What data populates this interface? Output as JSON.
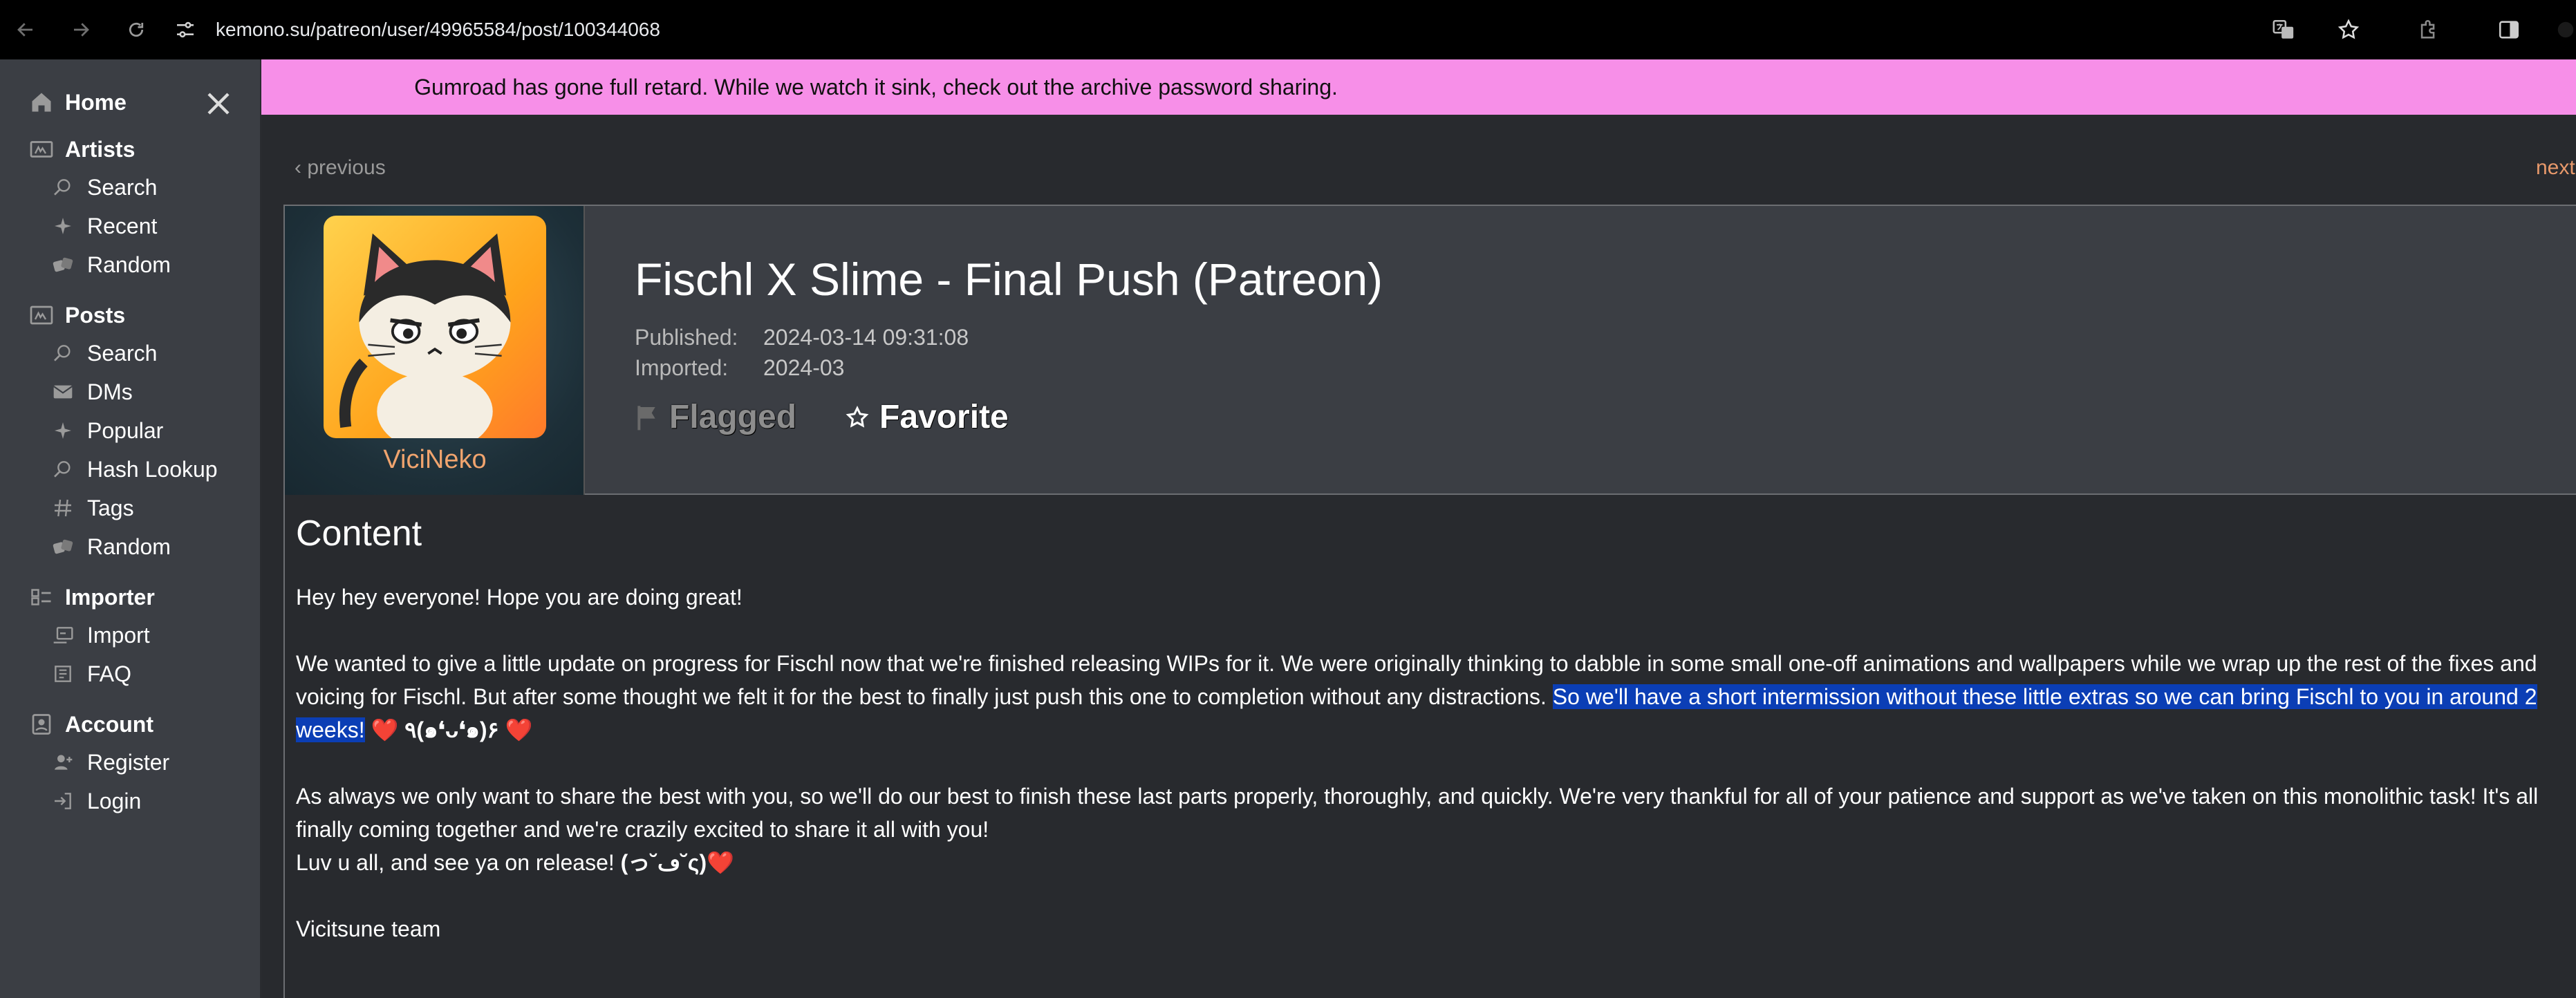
{
  "browser": {
    "url": "kemono.su/patreon/user/49965584/post/100344068"
  },
  "banner": {
    "text": "Gumroad has gone full retard. While we watch it sink, check out the archive password sharing."
  },
  "sidebar": {
    "home": "Home",
    "artists": {
      "label": "Artists",
      "items": [
        "Search",
        "Recent",
        "Random"
      ]
    },
    "posts": {
      "label": "Posts",
      "items": [
        "Search",
        "DMs",
        "Popular",
        "Hash Lookup",
        "Tags",
        "Random"
      ]
    },
    "importer": {
      "label": "Importer",
      "items": [
        "Import",
        "FAQ"
      ]
    },
    "account": {
      "label": "Account",
      "items": [
        "Register",
        "Login"
      ]
    }
  },
  "nav": {
    "previous": "‹ previous",
    "next": "next"
  },
  "post": {
    "username": "ViciNeko",
    "title": "Fischl X Slime - Final Push (Patreon)",
    "published_label": "Published:",
    "published_value": "2024-03-14 09:31:08",
    "imported_label": "Imported:",
    "imported_value": "2024-03",
    "flagged_label": "Flagged",
    "favorite_label": "Favorite"
  },
  "content": {
    "heading": "Content",
    "p1": "Hey hey everyone! Hope you are doing great!",
    "p2_start": "We wanted to give a little update on progress for Fischl now that we're finished releasing WIPs for it. We were originally thinking to dabble in some small one-off animations and wallpapers while we wrap up the rest of the fixes and voicing for Fischl. But after some thought we felt it for the best to finally just push this one to completion without any distractions. ",
    "p2_highlight": "So we'll have a short intermission without these little extras so we can bring Fischl to you in around 2 weeks!",
    "p2_heart1": " ❤️ ",
    "p2_face": "٩(๑❛ᴗ❛๑)۶",
    "p2_heart2": " ❤️",
    "p3": "As always we only want to share the best with you, so we'll do our best to finish these last parts properly, thoroughly, and quickly. We're very thankful for all of your patience and support as we've taken on this monolithic task! It's all finally coming together and we're crazily excited to share it all with you!",
    "p4_text": "Luv u all, and see ya on release! ",
    "p4_face": "(っ˘ڡ˘ς)",
    "p4_heart": "❤️",
    "p5": "Vicitsune team"
  }
}
